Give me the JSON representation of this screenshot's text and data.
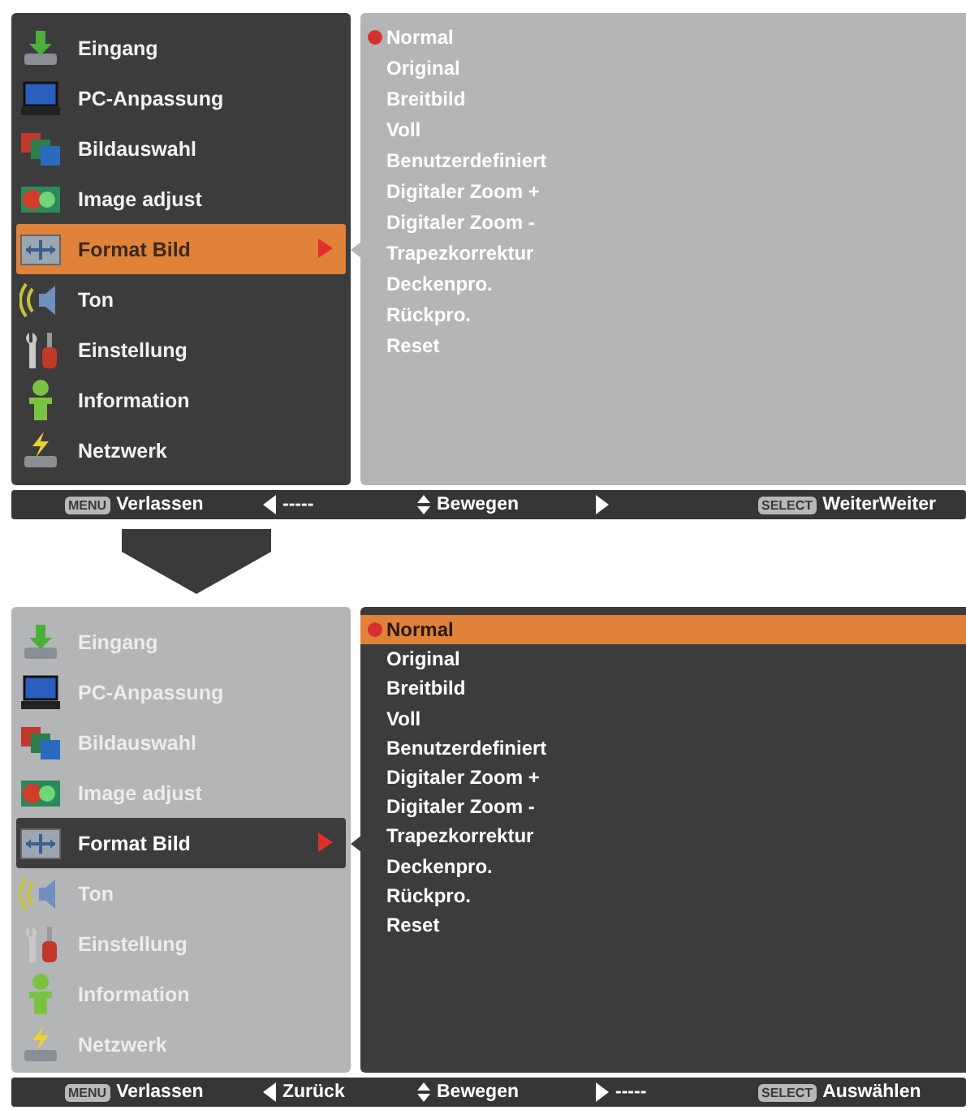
{
  "screens": [
    {
      "menu": {
        "focused": true,
        "items": [
          {
            "label": "Eingang",
            "selected": false
          },
          {
            "label": "PC-Anpassung",
            "selected": false
          },
          {
            "label": "Bildauswahl",
            "selected": false
          },
          {
            "label": "Image adjust",
            "selected": false
          },
          {
            "label": "Format Bild",
            "selected": true
          },
          {
            "label": "Ton",
            "selected": false
          },
          {
            "label": "Einstellung",
            "selected": false
          },
          {
            "label": "Information",
            "selected": false
          },
          {
            "label": "Netzwerk",
            "selected": false
          }
        ]
      },
      "submenu": {
        "focused": false,
        "items": [
          {
            "label": "Normal",
            "selected": false,
            "current": true
          },
          {
            "label": "Original",
            "selected": false,
            "current": false
          },
          {
            "label": "Breitbild",
            "selected": false,
            "current": false
          },
          {
            "label": "Voll",
            "selected": false,
            "current": false
          },
          {
            "label": "Benutzerdefiniert",
            "selected": false,
            "current": false
          },
          {
            "label": "Digitaler Zoom +",
            "selected": false,
            "current": false
          },
          {
            "label": "Digitaler Zoom -",
            "selected": false,
            "current": false
          },
          {
            "label": "Trapezkorrektur",
            "selected": false,
            "current": false
          },
          {
            "label": "Deckenpro.",
            "selected": false,
            "current": false
          },
          {
            "label": "Rückpro.",
            "selected": false,
            "current": false
          },
          {
            "label": "Reset",
            "selected": false,
            "current": false
          }
        ]
      },
      "footer": [
        {
          "kind": "key",
          "key": "MENU",
          "label": "Verlassen"
        },
        {
          "kind": "left",
          "label": "-----"
        },
        {
          "kind": "updown",
          "label": "Bewegen"
        },
        {
          "kind": "right"
        },
        {
          "kind": "key",
          "key": "SELECT",
          "label": "WeiterWeiter"
        }
      ]
    },
    {
      "menu": {
        "focused": false,
        "items": [
          {
            "label": "Eingang",
            "selected": false
          },
          {
            "label": "PC-Anpassung",
            "selected": false
          },
          {
            "label": "Bildauswahl",
            "selected": false
          },
          {
            "label": "Image adjust",
            "selected": false
          },
          {
            "label": "Format Bild",
            "selected": true
          },
          {
            "label": "Ton",
            "selected": false
          },
          {
            "label": "Einstellung",
            "selected": false
          },
          {
            "label": "Information",
            "selected": false
          },
          {
            "label": "Netzwerk",
            "selected": false
          }
        ]
      },
      "submenu": {
        "focused": true,
        "items": [
          {
            "label": "Normal",
            "selected": true,
            "current": true
          },
          {
            "label": "Original",
            "selected": false,
            "current": false
          },
          {
            "label": "Breitbild",
            "selected": false,
            "current": false
          },
          {
            "label": "Voll",
            "selected": false,
            "current": false
          },
          {
            "label": "Benutzerdefiniert",
            "selected": false,
            "current": false
          },
          {
            "label": "Digitaler Zoom +",
            "selected": false,
            "current": false
          },
          {
            "label": "Digitaler Zoom -",
            "selected": false,
            "current": false
          },
          {
            "label": "Trapezkorrektur",
            "selected": false,
            "current": false
          },
          {
            "label": "Deckenpro.",
            "selected": false,
            "current": false
          },
          {
            "label": "Rückpro.",
            "selected": false,
            "current": false
          },
          {
            "label": "Reset",
            "selected": false,
            "current": false
          }
        ]
      },
      "footer": [
        {
          "kind": "key",
          "key": "MENU",
          "label": "Verlassen"
        },
        {
          "kind": "left",
          "label": "Zurück"
        },
        {
          "kind": "updown",
          "label": "Bewegen"
        },
        {
          "kind": "right",
          "label": "-----"
        },
        {
          "kind": "key",
          "key": "SELECT",
          "label": "Auswählen"
        }
      ]
    }
  ]
}
